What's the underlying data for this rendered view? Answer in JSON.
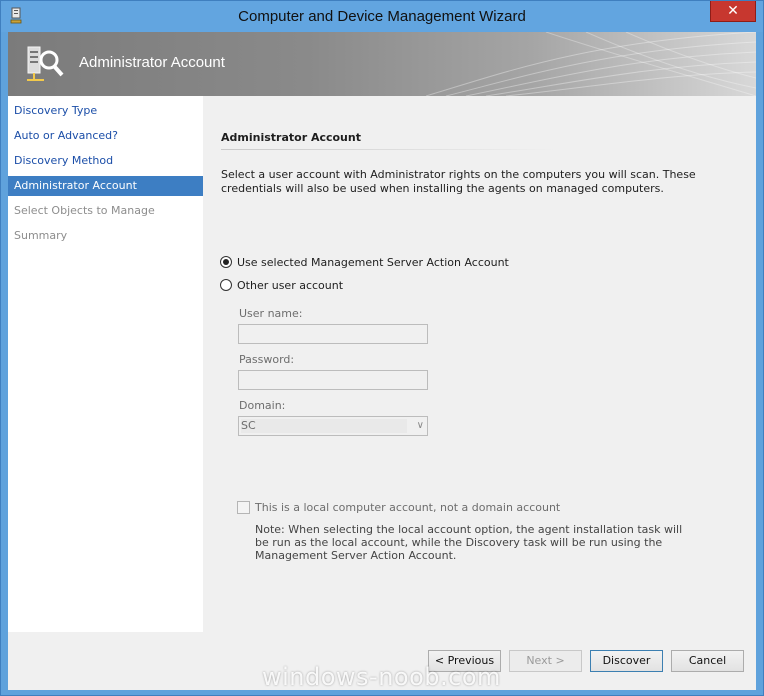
{
  "window": {
    "title": "Computer and Device Management Wizard",
    "close_label": "✕"
  },
  "banner": {
    "title": "Administrator Account",
    "icon": "server-search-icon"
  },
  "nav": {
    "items": [
      {
        "label": "Discovery Type",
        "state": "link"
      },
      {
        "label": "Auto or Advanced?",
        "state": "link"
      },
      {
        "label": "Discovery Method",
        "state": "link"
      },
      {
        "label": "Administrator Account",
        "state": "active"
      },
      {
        "label": "Select Objects to Manage",
        "state": "disabled"
      },
      {
        "label": "Summary",
        "state": "disabled"
      }
    ]
  },
  "content": {
    "section_title": "Administrator Account",
    "description": "Select a user account with Administrator rights on the computers you will scan. These credentials will also be used when installing the agents on managed computers.",
    "radio_options": [
      {
        "label": "Use selected Management Server Action Account",
        "checked": true
      },
      {
        "label": "Other user account",
        "checked": false
      }
    ],
    "fields": {
      "username_label": "User name:",
      "username_value": "",
      "password_label": "Password:",
      "password_value": "",
      "domain_label": "Domain:",
      "domain_value": "SC"
    },
    "local_account_checkbox": {
      "label": "This is a local computer account, not a domain account",
      "checked": false
    },
    "note": "Note:  When selecting the local account option, the agent installation task will be run as the local account, while the Discovery task will be run using the Management Server Action Account."
  },
  "footer": {
    "previous_label": "< Previous",
    "next_label": "Next >",
    "discover_label": "Discover",
    "cancel_label": "Cancel"
  },
  "watermark": "windows-noob.com",
  "colors": {
    "titlebar": "#62a5e0",
    "nav_active": "#3d7ec3",
    "nav_link": "#1b4ea8",
    "close": "#c7372f"
  }
}
